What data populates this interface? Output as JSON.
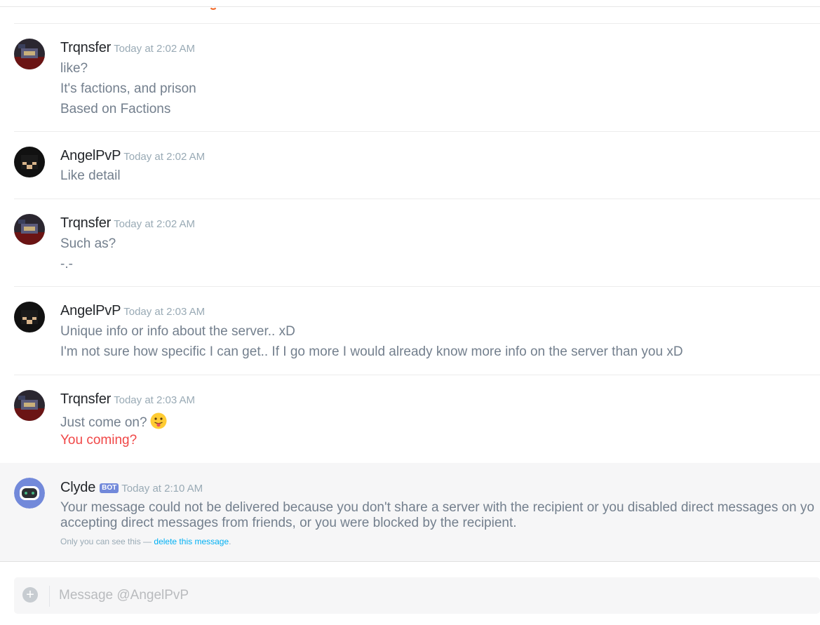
{
  "messages": [
    {
      "author": "Trqnsfer",
      "timestamp": "Today at 2:02 AM",
      "lines": [
        "like?",
        "It's factions, and prison",
        "Based on Factions"
      ]
    },
    {
      "author": "AngelPvP",
      "timestamp": "Today at 2:02 AM",
      "lines": [
        "Like detail"
      ]
    },
    {
      "author": "Trqnsfer",
      "timestamp": "Today at 2:02 AM",
      "lines": [
        "Such as?",
        "-.-"
      ]
    },
    {
      "author": "AngelPvP",
      "timestamp": "Today at 2:03 AM",
      "lines": [
        "Unique info or info about the server.. xD",
        "I'm not sure how specific I can get.. If I go more I would already know more info on the server than you xD"
      ]
    },
    {
      "author": "Trqnsfer",
      "timestamp": "Today at 2:03 AM",
      "lines": [
        "Just come on?",
        "You coming?"
      ],
      "emoji": "tongue-face-emoji"
    }
  ],
  "clyde": {
    "author": "Clyde",
    "bot_tag": "BOT",
    "timestamp": "Today at 2:10 AM",
    "lines": [
      "Your message could not be delivered because you don't share a server with the recipient or you disabled direct messages on yo",
      "accepting direct messages from friends, or you were blocked by the recipient."
    ],
    "note_prefix": "Only you can see this — ",
    "note_link": "delete this message",
    "note_suffix": "."
  },
  "composer": {
    "placeholder": "Message @AngelPvP",
    "upload_icon": "plus-circle-icon"
  },
  "colors": {
    "username": "#23262a",
    "timestamp": "#99aab5",
    "body_text": "#737f8d",
    "highlight_red": "#f04747",
    "bot_tag": "#7289da",
    "link": "#00b0f4",
    "bot_background": "#f6f6f7"
  }
}
